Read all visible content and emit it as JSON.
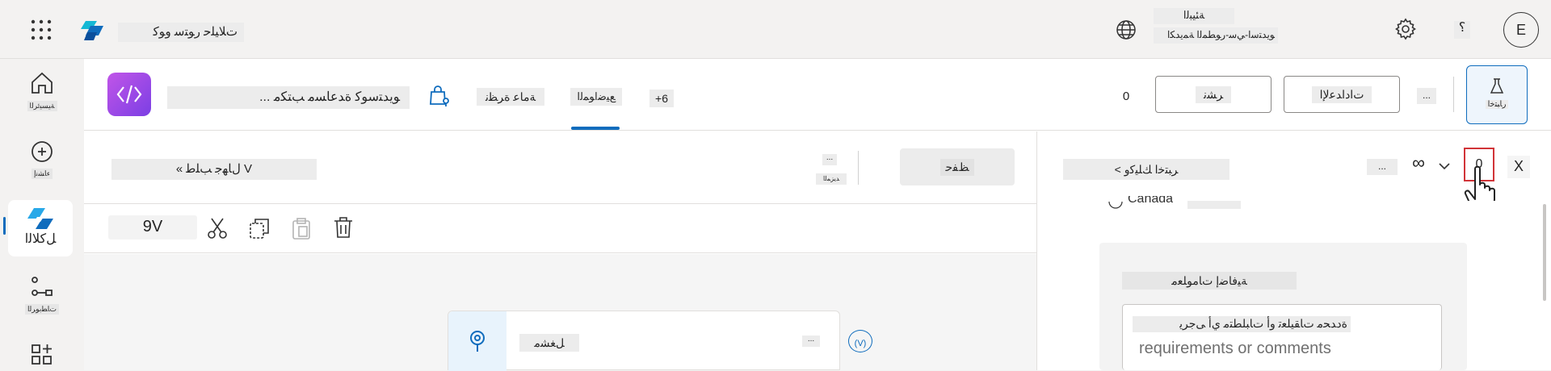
{
  "topbar": {
    "app_title": "ﺕﻼﻴﻠﺣ ﺭﻮﺘﺳ ﻭﻮﻛ",
    "environment_label": "ﺔﺌﻴﺒﻟﺍ",
    "environment_name": "ﻮﻳﺪﺘﺳﺍ-ﻲﺳ-ﺭﻮﻄﻤﻟﺍ ﺔﻤﻳﺪﻜﺍ",
    "help": "؟",
    "avatar_initial": "E"
  },
  "leftnav": {
    "items": [
      {
        "label": "ﺔﻴﺴﻴﺋﺮﻟﺍ"
      },
      {
        "label": "ﺀﺎﺸﻧﺇ"
      },
      {
        "label": "ﻞﻛﻼﻟﺍ"
      },
      {
        "label": "ﺕﺎﻄﺑﻮﺮﻟﺍ"
      }
    ]
  },
  "agent_header": {
    "name": "... ﻮﻳﺪﺘﺳﻮﻛ ﺓﺪﻋﺎﺴﻣ ﺐﺘﻜﻣ",
    "tabs": [
      {
        "label": "ﺔﻣﺎﻋ ﺓﺮﻈﻧ"
      },
      {
        "label": "ﻊﻴﺿﺍﻮﻤﻟﺍ"
      },
      {
        "label": "+6"
      }
    ],
    "badge_count": "0",
    "share_label": "ﺮﺸﻧ",
    "settings_label": "ﺕﺍﺩﺍﺪﻋﻹﺍ",
    "more_label": "...",
    "test_label": "ﺭﺎﺒﺘﺧﺍ"
  },
  "canvas": {
    "topic_title": "« ﻝﺎﻬﺟ ﺐﻠﻃ V",
    "more_small": "...",
    "more_caption": "ﺪﻳﺰﻤﻟﺍ",
    "save_label": "ﻆﻔﺣ",
    "zoom": "9V",
    "node_title": "ﻞﻐﺸﻣ",
    "node_more": "...",
    "variable_badge": "(V)"
  },
  "rightpane": {
    "panel_title": "< ﺮﺒﺘﺧﺍ ﻚﻠﻴﻛﻭ",
    "more": "...",
    "infinity": "∞",
    "refresh_count": "0",
    "close": "X",
    "partial_text": "Canada",
    "card_title": "ﺔﻴﻓﺎﺿﺇ ﺕﺎﻣﻮﻠﻌﻣ",
    "textarea_rtl": "ﺓﺩﺪﺤﻣ ﺕﺎﻘﻴﻠﻌﺗ ﻭﺃ ﺕﺎﺒﻠﻄﺘﻣ ﻱﺃ ﻰﺟﺮﻳ",
    "textarea_placeholder": "requirements or comments"
  },
  "colors": {
    "accent": "#0f6cbd",
    "highlight": "#d13438",
    "logo_gradient_start": "#c155e8",
    "logo_gradient_end": "#7b3fe4"
  }
}
